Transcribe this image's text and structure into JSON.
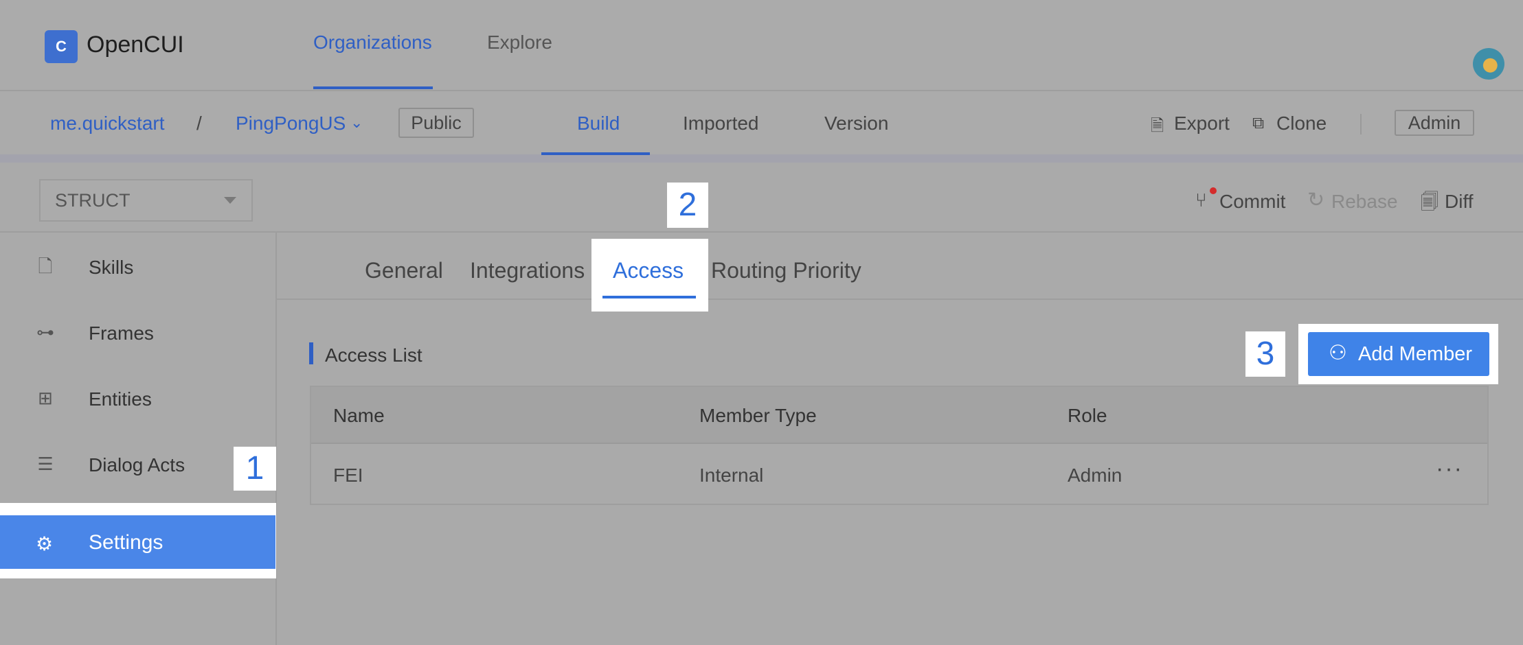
{
  "app": {
    "name": "OpenCUI",
    "logo_glyph": "C"
  },
  "top_tabs": {
    "organizations": "Organizations",
    "explore": "Explore"
  },
  "project": {
    "org": "me.quickstart",
    "separator": "/",
    "name": "PingPongUS",
    "visibility": "Public",
    "tabs": {
      "build": "Build",
      "imported": "Imported",
      "version": "Version"
    },
    "actions": {
      "export": "Export",
      "clone": "Clone",
      "role": "Admin"
    }
  },
  "toolbar": {
    "mode_select": "STRUCT",
    "commit": "Commit",
    "rebase": "Rebase",
    "diff": "Diff"
  },
  "sidebar": {
    "items": [
      {
        "label": "Skills",
        "icon": "document-icon"
      },
      {
        "label": "Frames",
        "icon": "frames-icon"
      },
      {
        "label": "Entities",
        "icon": "entities-icon"
      },
      {
        "label": "Dialog Acts",
        "icon": "dialog-acts-icon"
      },
      {
        "label": "Settings",
        "icon": "gear-icon",
        "active": true
      }
    ]
  },
  "settings_tabs": {
    "general": "General",
    "integrations": "Integrations",
    "access": "Access",
    "routing": "Routing Priority"
  },
  "access_list": {
    "title": "Access List",
    "add_button": "Add Member",
    "columns": [
      "Name",
      "Member Type",
      "Role"
    ],
    "rows": [
      {
        "name": "FEI",
        "member_type": "Internal",
        "role": "Admin"
      }
    ],
    "row_more": "···"
  },
  "callouts": [
    "1",
    "2",
    "3"
  ],
  "colors": {
    "accent": "#2f5fc4",
    "active_row": "#4a86e8",
    "button": "#3f83e8",
    "commit_dot": "#d42c2c"
  }
}
